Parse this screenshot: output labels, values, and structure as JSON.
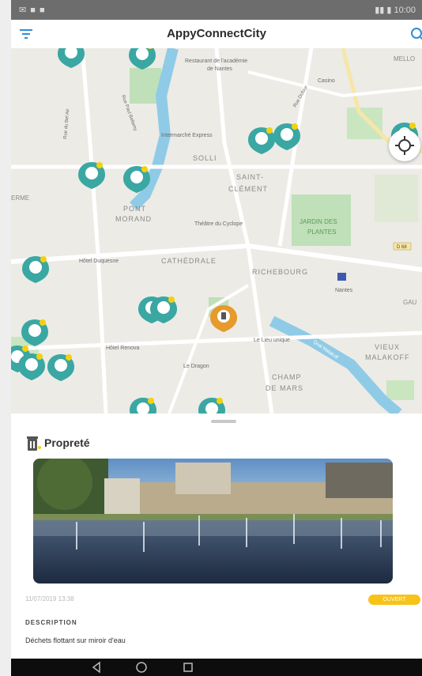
{
  "status_bar": {
    "left": "✉ ■ ■",
    "right": "▮▮ ▮ 10:00"
  },
  "app": {
    "title": "AppyConnectCity"
  },
  "map": {
    "labels": {
      "restaurant": "Restaurant de l'académie",
      "restaurant2": "de Nantes",
      "casino": "Casino",
      "intermarche": "Intermarché Express",
      "solli": "SOLLI",
      "saint": "SAINT-",
      "clement": "CLÉMENT",
      "pont": "PONT",
      "morand": "MORAND",
      "theatre": "Théâtre du Cyclope",
      "jardin": "JARDIN DES",
      "plantes": "PLANTES",
      "hotel_duquesne": "Hôtel Duquesne",
      "cathedrale": "CATHÉDRALE",
      "richebourg": "RICHEBOURG",
      "nantes": "Nantes",
      "le_lieu_unique": "Le Lieu unique",
      "hotel_renova": "Hôtel Renova",
      "le_dragon": "Le Dragon",
      "champ": "CHAMP",
      "de_mars": "DE MARS",
      "vieux": "VIEUX",
      "malakoff": "MALAKOFF",
      "erme": "ERME",
      "mello": "MELLO",
      "gau": "GAU",
      "rue_bel_air": "Rue du Bel Air",
      "rue_paris": "Rue Paul Bellamy",
      "rue_dufour": "Rue Dufour",
      "quai": "Quai Malakoff",
      "route": "D 68"
    }
  },
  "detail": {
    "category": "Propreté",
    "date": "11/07/2019 13:38",
    "status": "OUVERT",
    "description_heading": "DESCRIPTION",
    "description": "Déchets flottant sur miroir d'eau"
  },
  "colors": {
    "pin_teal": "#3aa7a3",
    "pin_orange": "#e59a2b",
    "dot_yellow": "#f4d10e",
    "badge": "#f7c318"
  },
  "icons": [
    "filter-icon",
    "search-icon",
    "my-location-icon",
    "trash-icon",
    "back-icon",
    "home-icon",
    "recents-icon"
  ]
}
